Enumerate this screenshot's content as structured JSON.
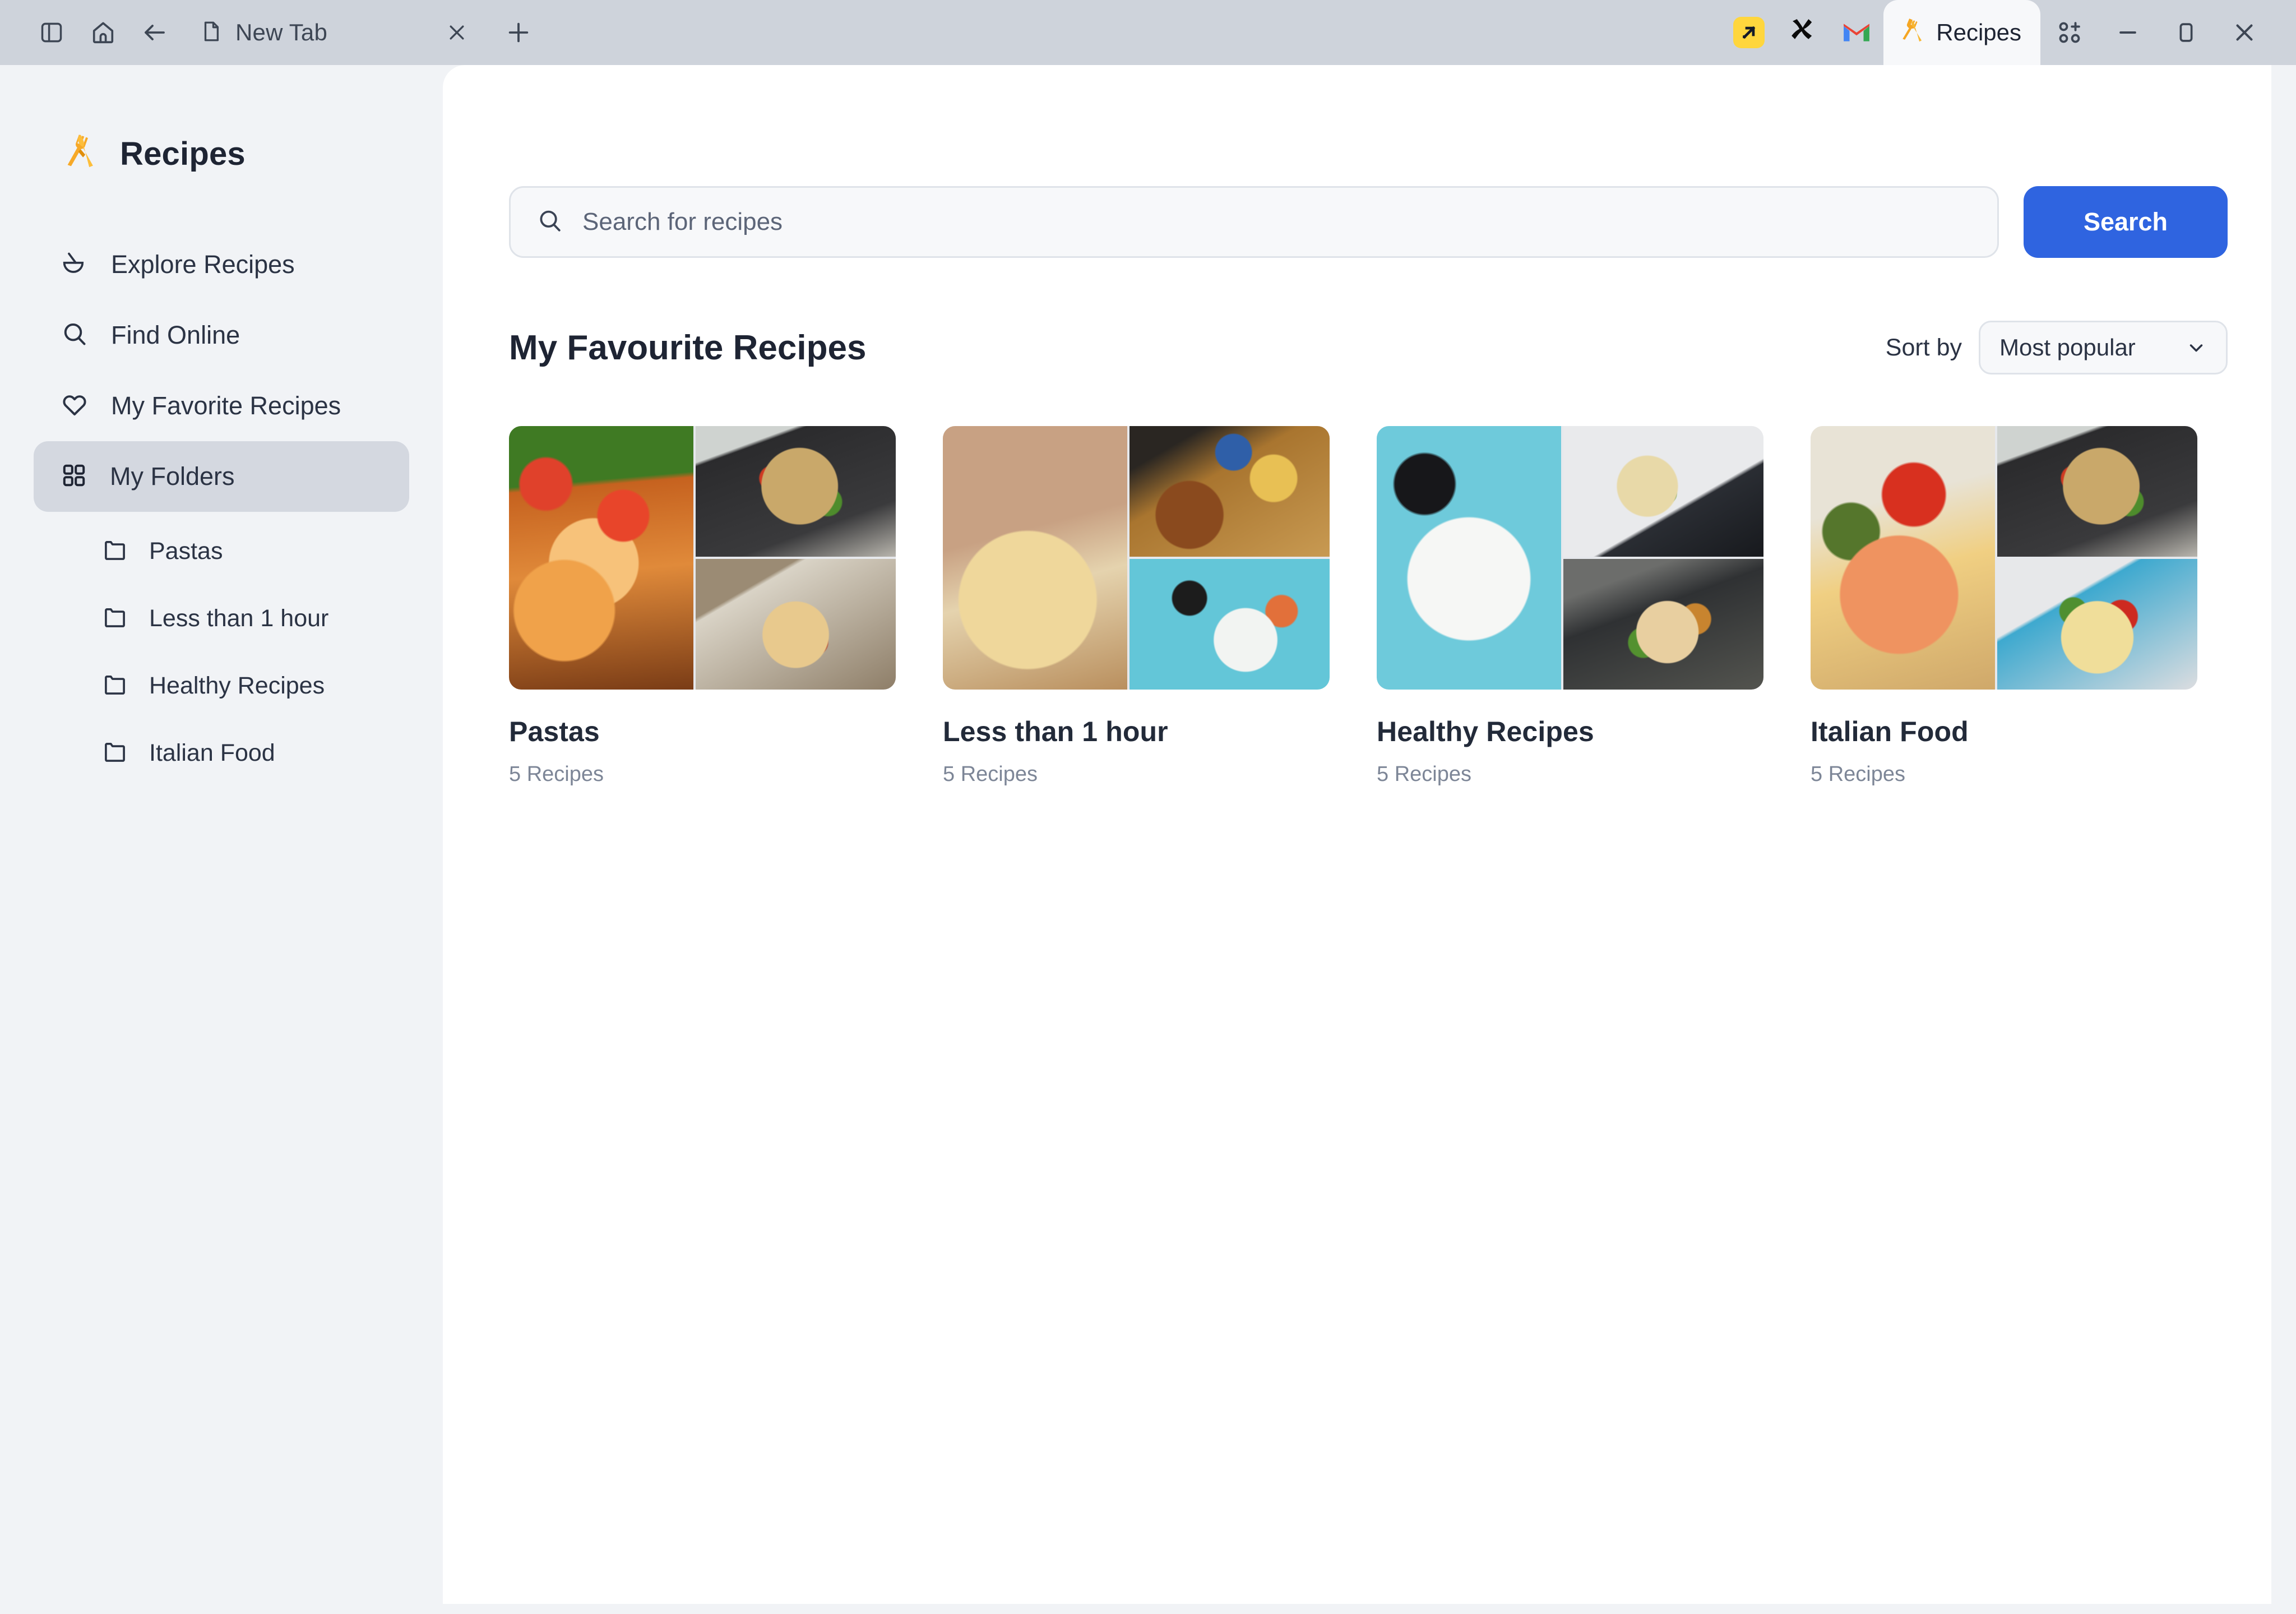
{
  "browser": {
    "toolbar_icons": [
      "sidebar-toggle-icon",
      "home-icon",
      "back-arrow-icon"
    ],
    "tab": {
      "label": "New Tab",
      "icon": "document-icon",
      "close": "×",
      "new_tab": "+"
    },
    "pinned_apps": [
      {
        "name": "yellow-arrow-app-icon"
      },
      {
        "name": "x-logo-icon"
      },
      {
        "name": "gmail-icon"
      }
    ],
    "active_tab": {
      "label": "Recipes",
      "icon": "fork-spoon-icon"
    },
    "add_apps_icon": "grid-plus-icon",
    "window_controls": {
      "minimize": "minimize-icon",
      "maximize": "maximize-icon",
      "close": "close-icon"
    }
  },
  "sidebar": {
    "brand": {
      "title": "Recipes",
      "logo": "fork-spoon-icon"
    },
    "items": [
      {
        "label": "Explore Recipes",
        "icon": "bowl-icon",
        "active": false
      },
      {
        "label": "Find Online",
        "icon": "search-icon",
        "active": false
      },
      {
        "label": "My Favorite Recipes",
        "icon": "heart-icon",
        "active": false
      },
      {
        "label": "My Folders",
        "icon": "grid-icon",
        "active": true
      }
    ],
    "folders": [
      {
        "label": "Pastas",
        "icon": "folder-icon"
      },
      {
        "label": "Less than 1 hour",
        "icon": "folder-icon"
      },
      {
        "label": "Healthy Recipes",
        "icon": "folder-icon"
      },
      {
        "label": "Italian Food",
        "icon": "folder-icon"
      }
    ]
  },
  "main": {
    "search": {
      "placeholder": "Search for recipes",
      "value": "",
      "icon": "search-icon",
      "button_label": "Search"
    },
    "section_title": "My Favourite Recipes",
    "sort": {
      "label": "Sort by",
      "value": "Most popular",
      "caret": "chevron-down-icon"
    },
    "cards": [
      {
        "title": "Pastas",
        "count": "5 Recipes"
      },
      {
        "title": "Less than 1 hour",
        "count": "5 Recipes"
      },
      {
        "title": "Healthy Recipes",
        "count": "5 Recipes"
      },
      {
        "title": "Italian Food",
        "count": "5 Recipes"
      }
    ]
  },
  "colors": {
    "accent_blue": "#2f64e0",
    "chrome_bg": "#ced3db",
    "sidebar_bg": "#f1f3f6",
    "panel_bg": "#ffffff",
    "active_item_bg": "#d4d8e0",
    "brand_yellow": "#f5a623"
  }
}
